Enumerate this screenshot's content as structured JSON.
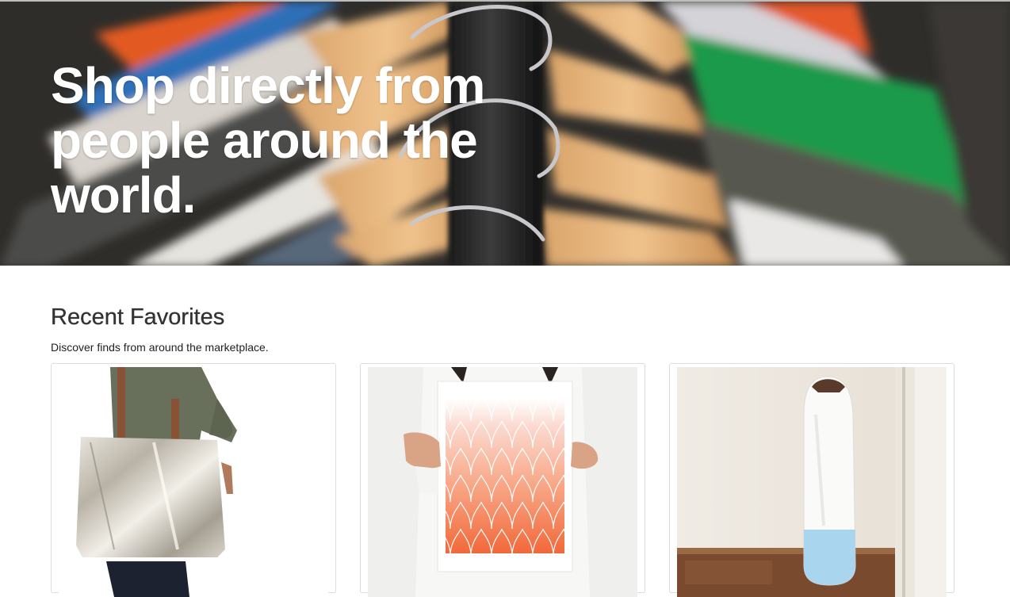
{
  "hero": {
    "title_line1": "Shop directly from",
    "title_line2": "people around the",
    "title_line3": "world."
  },
  "favorites": {
    "title": "Recent Favorites",
    "subtitle": "Discover finds from around the marketplace.",
    "items": [
      {
        "image": "silver-tote-bag"
      },
      {
        "image": "coral-scale-print"
      },
      {
        "image": "surfboard-sock"
      }
    ]
  },
  "colors": {
    "hero_bg": "#2c2b29",
    "text": "#333333",
    "card_border": "#dcdcdc"
  }
}
